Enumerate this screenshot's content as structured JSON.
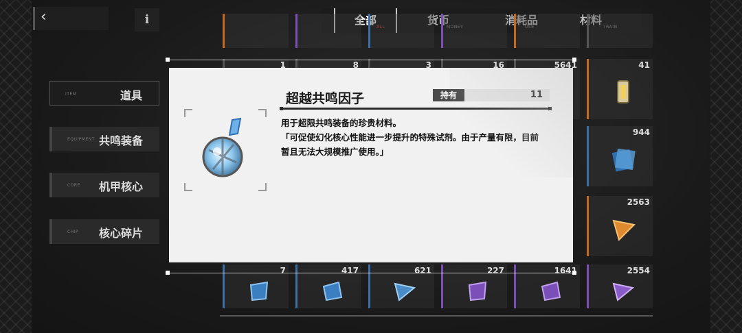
{
  "topbar": {
    "back_glyph": "‹",
    "info_glyph": "i",
    "tabs": [
      {
        "label": "全部",
        "sub": "ALL",
        "active": true
      },
      {
        "label": "货币",
        "sub": "MONEY",
        "active": false
      },
      {
        "label": "消耗品",
        "sub": "USE",
        "active": false
      },
      {
        "label": "材料",
        "sub": "TRAIN",
        "active": false
      }
    ]
  },
  "sidebar": {
    "items": [
      {
        "label": "道具",
        "sub": "ITEM",
        "active": true
      },
      {
        "label": "共鸣装备",
        "sub": "EQUIPMENT",
        "active": false
      },
      {
        "label": "机甲核心",
        "sub": "CORE",
        "active": false
      },
      {
        "label": "核心碎片",
        "sub": "CHIP",
        "active": false
      }
    ]
  },
  "grid": {
    "row1_counts": [
      "1",
      "8",
      "3",
      "16",
      "5641",
      "41"
    ],
    "right_column": [
      "944",
      "2563"
    ],
    "bottom_row": [
      "7",
      "417",
      "621",
      "227",
      "1641",
      "2554"
    ]
  },
  "dialog": {
    "item_name": "超越共鸣因子",
    "owned_label": "持有",
    "owned_value": "11",
    "desc_line1": "用于超限共鸣装备的珍贵材料。",
    "desc_line2": "「可促使幻化核心性能进一步提升的特殊试剂。由于产量有限，目前暂且无法大规模推广使用。」",
    "icon": "resonance-factor-icon"
  },
  "colors": {
    "accent_red": "#e04040",
    "dialog_bg": "#f1f1f1"
  }
}
